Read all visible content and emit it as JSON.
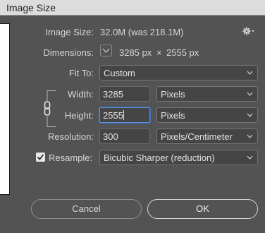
{
  "window": {
    "title": "Image Size"
  },
  "image_size": {
    "label": "Image Size:",
    "value": "32.0M (was 218.1M)"
  },
  "dimensions": {
    "label": "Dimensions:",
    "width": "3285 px",
    "times": "×",
    "height": "2555 px"
  },
  "fit_to": {
    "label": "Fit To:",
    "selected": "Custom"
  },
  "width": {
    "label": "Width:",
    "value": "3285",
    "unit": "Pixels"
  },
  "height": {
    "label": "Height:",
    "value": "2555",
    "unit": "Pixels"
  },
  "resolution": {
    "label": "Resolution:",
    "value": "300",
    "unit": "Pixels/Centimeter"
  },
  "resample": {
    "label": "Resample:",
    "checked": true,
    "method": "Bicubic Sharper (reduction)"
  },
  "buttons": {
    "cancel": "Cancel",
    "ok": "OK"
  },
  "icons": {
    "settings": "gear-icon",
    "dimensions_toggle": "chevron-down-icon",
    "constrain": "chain-link-icon",
    "select_arrow": "chevron-down-icon",
    "resample_check": "checkmark-icon"
  },
  "colors": {
    "dialog_bg": "#535353",
    "title_bar": "#dcdcdc",
    "focus_ring": "#5b8fd6",
    "field_bg": "#454545"
  }
}
